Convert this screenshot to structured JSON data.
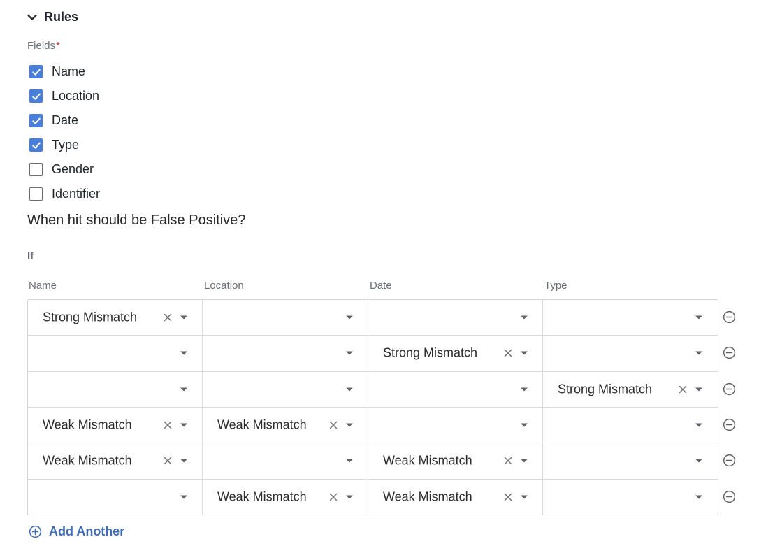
{
  "section": {
    "title": "Rules",
    "icon": "chevron-down-icon"
  },
  "fields": {
    "label": "Fields",
    "required_mark": "*",
    "options": [
      {
        "label": "Name",
        "checked": true
      },
      {
        "label": "Location",
        "checked": true
      },
      {
        "label": "Date",
        "checked": true
      },
      {
        "label": "Type",
        "checked": true
      },
      {
        "label": "Gender",
        "checked": false
      },
      {
        "label": "Identifier",
        "checked": false
      }
    ]
  },
  "question": "When hit should be False Positive?",
  "condition_label": "If",
  "columns": [
    "Name",
    "Location",
    "Date",
    "Type"
  ],
  "rows": [
    [
      "Strong Mismatch",
      "",
      "",
      ""
    ],
    [
      "",
      "",
      "Strong Mismatch",
      ""
    ],
    [
      "",
      "",
      "",
      "Strong Mismatch"
    ],
    [
      "Weak Mismatch",
      "Weak Mismatch",
      "",
      ""
    ],
    [
      "Weak Mismatch",
      "",
      "Weak Mismatch",
      ""
    ],
    [
      "",
      "Weak Mismatch",
      "Weak Mismatch",
      ""
    ]
  ],
  "add_another": {
    "label": "Add Another",
    "icon": "plus-circle-icon"
  },
  "colors": {
    "accent": "#4a7fd9",
    "link": "#3f6cb4",
    "required": "#d13438"
  }
}
